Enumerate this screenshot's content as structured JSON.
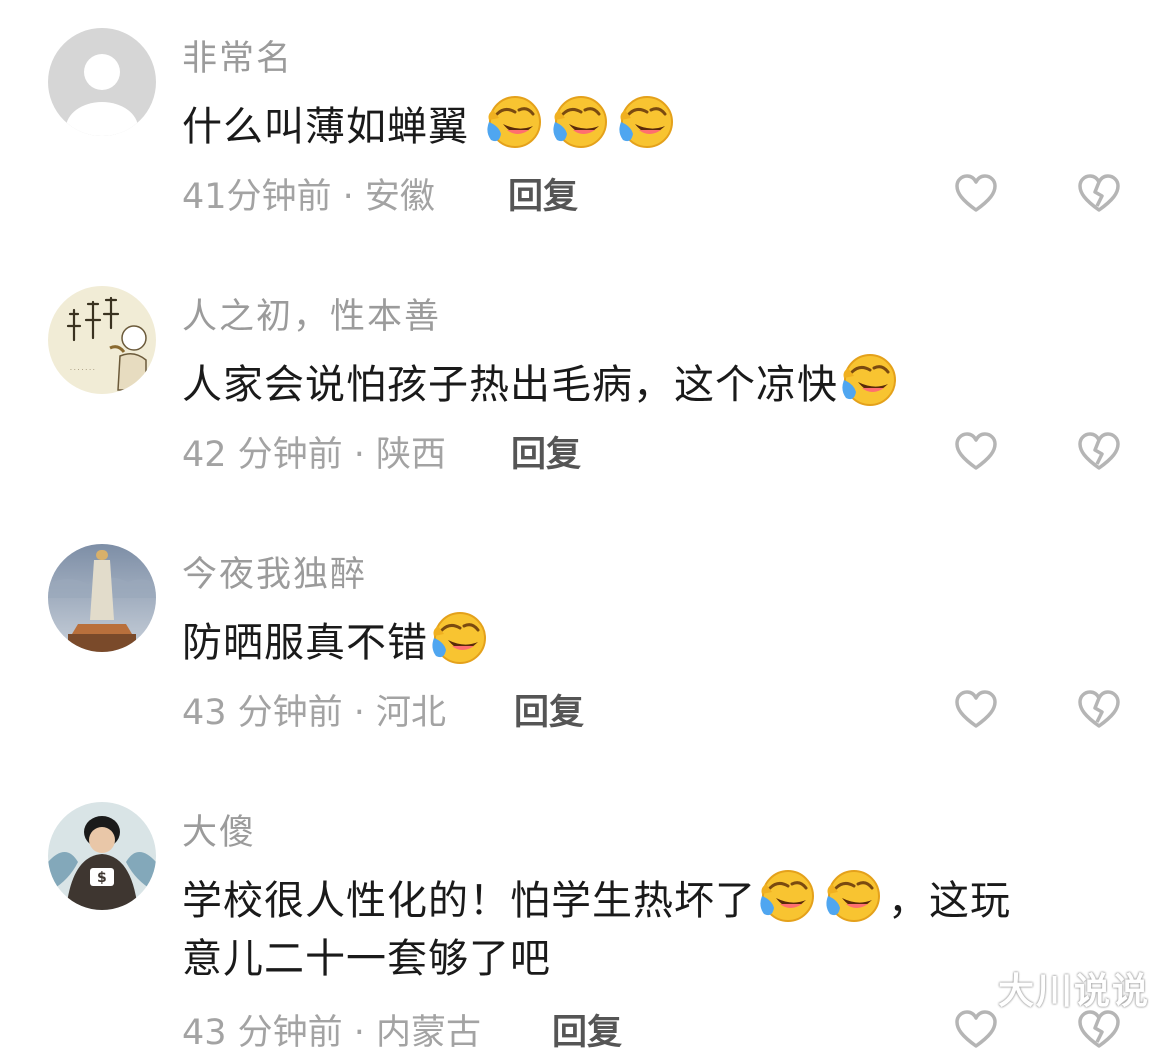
{
  "comments": [
    {
      "username": "非常名",
      "text": "什么叫薄如蝉翼",
      "text2": "",
      "emojis_after_text": 3,
      "emojis_mid": 0,
      "meta": "41分钟前 · 安徽",
      "reply": "回复",
      "avatar": "default-avatar-icon"
    },
    {
      "username": "人之初，性本善",
      "text": "人家会说怕孩子热出毛病，这个凉快",
      "text2": "",
      "emojis_after_text": 1,
      "emojis_mid": 0,
      "meta": "42 分钟前 · 陕西",
      "reply": "回复",
      "avatar": "calligraphy-avatar"
    },
    {
      "username": "今夜我独醉",
      "text": "防晒服真不错",
      "text2": "",
      "emojis_after_text": 1,
      "emojis_mid": 0,
      "meta": "43 分钟前 · 河北",
      "reply": "回复",
      "avatar": "statue-avatar"
    },
    {
      "username": "大傻",
      "text": "学校很人性化的！怕学生热坏了",
      "text_after": "，这玩",
      "text2": "意儿二十一套够了吧",
      "emojis_mid": 2,
      "meta": "43 分钟前 · 内蒙古",
      "reply": "回复",
      "avatar": "person-avatar"
    }
  ],
  "icons": {
    "like": "heart-outline-icon",
    "dislike": "broken-heart-icon",
    "emoji": "laughing-crying-emoji-icon"
  },
  "watermark": "大川说说",
  "colors": {
    "text": "#1a1a1a",
    "muted": "#a3a3a3",
    "reply": "#555555",
    "emoji": "#f8c431"
  }
}
